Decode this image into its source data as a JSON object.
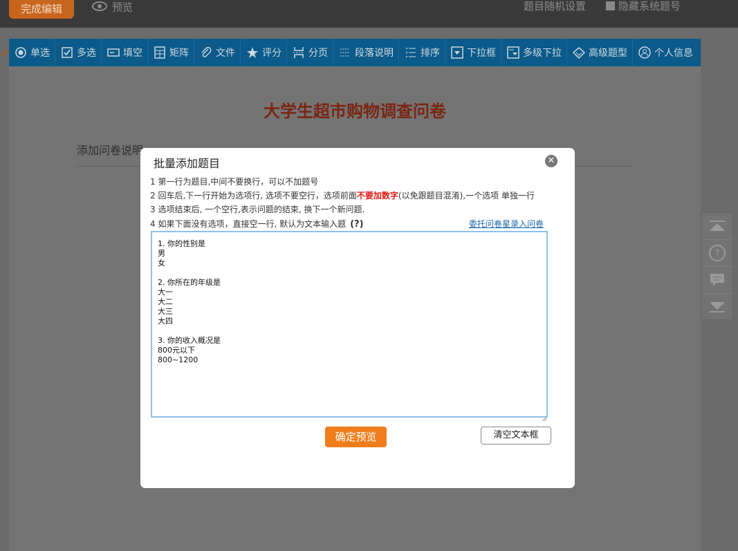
{
  "topbar": {
    "finish_label": "完成编辑",
    "preview_label": "预览",
    "random_setting_label": "题目随机设置",
    "hide_number_label": "隐藏系统题号"
  },
  "toolbar": {
    "items": [
      {
        "label": "单选",
        "icon": "radio-icon"
      },
      {
        "label": "多选",
        "icon": "checkbox-icon"
      },
      {
        "label": "填空",
        "icon": "fill-blank-icon"
      },
      {
        "label": "矩阵",
        "icon": "matrix-icon"
      },
      {
        "label": "文件",
        "icon": "paperclip-icon"
      },
      {
        "label": "评分",
        "icon": "rating-icon"
      },
      {
        "label": "分页",
        "icon": "page-break-icon"
      },
      {
        "label": "段落说明",
        "icon": "paragraph-icon"
      },
      {
        "label": "排序",
        "icon": "sort-icon"
      },
      {
        "label": "下拉框",
        "icon": "dropdown-icon"
      },
      {
        "label": "多级下拉",
        "icon": "multi-dropdown-icon"
      },
      {
        "label": "高级题型",
        "icon": "diamond-icon"
      },
      {
        "label": "个人信息",
        "icon": "person-icon"
      }
    ]
  },
  "page": {
    "survey_title": "大学生超市购物调查问卷",
    "add_description": "添加问卷说明"
  },
  "modal": {
    "title": "批量添加题目",
    "instructions": {
      "line1": "1 第一行为题目,中间不要换行，可以不加题号",
      "line2_pre": "2 回车后,下一行开始为选项行, 选项不要空行，选项前面",
      "line2_red": "不要加数字",
      "line2_post": "(以免跟题目混淆),一个选项 单独一行",
      "line3": "3 选项结束后, 一个空行,表示问题的结束, 换下一个新问题.",
      "line4": "4 如果下面没有选项，直接空一行, 默认为文本输入题",
      "line4_help": "(?)"
    },
    "delegate_link": "委托问卷星录入问卷",
    "textarea_content": "1. 你的性别是\n男\n女\n\n2. 你所在的年级是\n大一\n大二\n大三\n大四\n\n3. 你的收入概况是\n800元以下\n800~1200",
    "confirm_label": "确定预览",
    "clear_label": "清空文本框"
  },
  "colors": {
    "toolbar_bg": "#0b5a8a",
    "accent_orange": "#ef7d1c",
    "title_red": "#7a2512",
    "warning_red": "#e31b10",
    "link_blue": "#1b64a8"
  }
}
